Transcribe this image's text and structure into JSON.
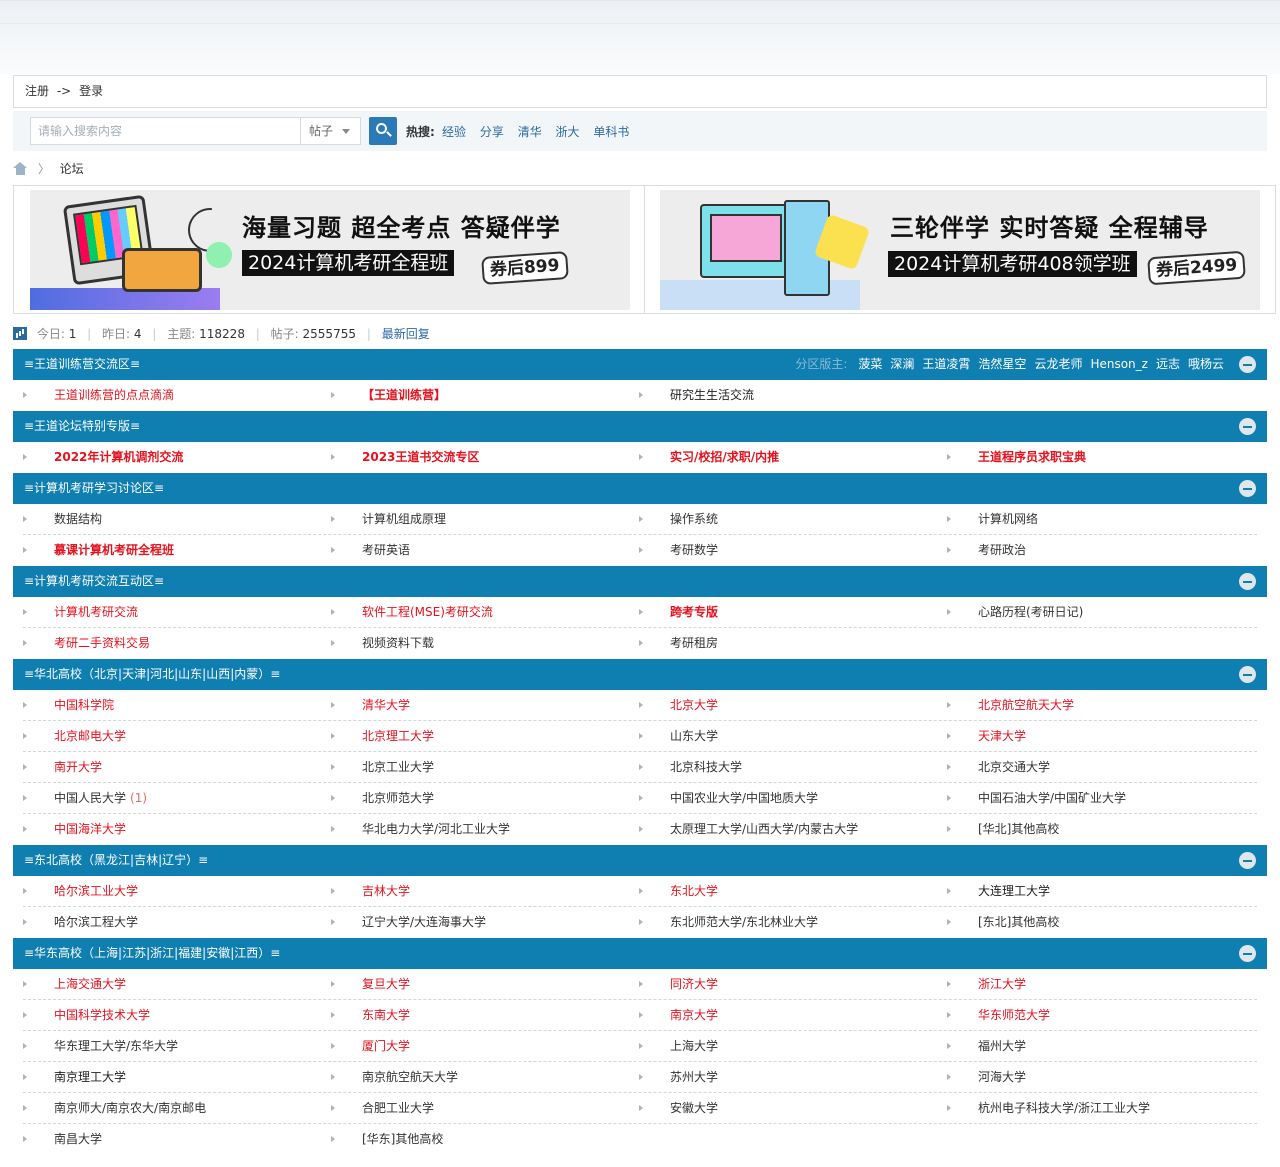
{
  "top": {
    "register": "注册",
    "arrow": "->",
    "login": "登录"
  },
  "search": {
    "placeholder": "请输入搜索内容",
    "type": "帖子",
    "hot_label": "热搜:",
    "hot": [
      "经验",
      "分享",
      "清华",
      "浙大",
      "单科书"
    ]
  },
  "breadcrumb": {
    "current": "论坛"
  },
  "banners": [
    {
      "slogan": "海量习题 超全考点 答疑伴学",
      "course": "2024计算机考研全程班",
      "price": "券后899"
    },
    {
      "slogan": "三轮伴学 实时答疑 全程辅导",
      "course": "2024计算机考研408领学班",
      "price": "券后2499"
    }
  ],
  "stats": {
    "today_label": "今日:",
    "today": "1",
    "yesterday_label": "昨日:",
    "yesterday": "4",
    "topics_label": "主题:",
    "topics": "118228",
    "posts_label": "帖子:",
    "posts": "2555755",
    "latest": "最新回复"
  },
  "categories": [
    {
      "title": "≡王道训练营交流区≡",
      "mod_label": "分区版主:",
      "mods": [
        "菠菜",
        "深澜",
        "王道凌霄",
        "浩然星空",
        "云龙老师",
        "Henson_z",
        "远志",
        "哦杨云"
      ],
      "rows": [
        [
          {
            "name": "王道训练营的点点滴滴",
            "style": "red"
          },
          {
            "name": "【王道训练营】",
            "style": "red-bold"
          },
          {
            "name": "研究生生活交流",
            "style": "black"
          }
        ]
      ]
    },
    {
      "title": "≡王道论坛特别专版≡",
      "rows": [
        [
          {
            "name": "2022年计算机调剂交流",
            "style": "red-bold"
          },
          {
            "name": "2023王道书交流专区",
            "style": "red-bold"
          },
          {
            "name": "实习/校招/求职/内推",
            "style": "red-bold"
          },
          {
            "name": "王道程序员求职宝典",
            "style": "red-bold"
          }
        ]
      ]
    },
    {
      "title": "≡计算机考研学习讨论区≡",
      "rows": [
        [
          {
            "name": "数据结构",
            "style": "normal"
          },
          {
            "name": "计算机组成原理",
            "style": "normal"
          },
          {
            "name": "操作系统",
            "style": "normal"
          },
          {
            "name": "计算机网络",
            "style": "normal"
          }
        ],
        [
          {
            "name": "慕课计算机考研全程班",
            "style": "red-bold"
          },
          {
            "name": "考研英语",
            "style": "normal"
          },
          {
            "name": "考研数学",
            "style": "normal"
          },
          {
            "name": "考研政治",
            "style": "normal"
          }
        ]
      ]
    },
    {
      "title": "≡计算机考研交流互动区≡",
      "rows": [
        [
          {
            "name": "计算机考研交流",
            "style": "red"
          },
          {
            "name": "软件工程(MSE)考研交流",
            "style": "red"
          },
          {
            "name": "跨考专版",
            "style": "red-bold"
          },
          {
            "name": "心路历程(考研日记)",
            "style": "normal"
          }
        ],
        [
          {
            "name": "考研二手资料交易",
            "style": "red"
          },
          {
            "name": "视频资料下载",
            "style": "normal"
          },
          {
            "name": "考研租房",
            "style": "normal"
          }
        ]
      ]
    },
    {
      "title": "≡华北高校（北京|天津|河北|山东|山西|内蒙）≡",
      "rows": [
        [
          {
            "name": "中国科学院",
            "style": "red"
          },
          {
            "name": "清华大学",
            "style": "red"
          },
          {
            "name": "北京大学",
            "style": "red"
          },
          {
            "name": "北京航空航天大学",
            "style": "red"
          }
        ],
        [
          {
            "name": "北京邮电大学",
            "style": "red"
          },
          {
            "name": "北京理工大学",
            "style": "red"
          },
          {
            "name": "山东大学",
            "style": "normal"
          },
          {
            "name": "天津大学",
            "style": "red"
          }
        ],
        [
          {
            "name": "南开大学",
            "style": "red"
          },
          {
            "name": "北京工业大学",
            "style": "normal"
          },
          {
            "name": "北京科技大学",
            "style": "normal"
          },
          {
            "name": "北京交通大学",
            "style": "normal"
          }
        ],
        [
          {
            "name": "中国人民大学",
            "style": "normal",
            "count": "(1)"
          },
          {
            "name": "北京师范大学",
            "style": "normal"
          },
          {
            "name": "中国农业大学/中国地质大学",
            "style": "normal"
          },
          {
            "name": "中国石油大学/中国矿业大学",
            "style": "normal"
          }
        ],
        [
          {
            "name": "中国海洋大学",
            "style": "red"
          },
          {
            "name": "华北电力大学/河北工业大学",
            "style": "normal"
          },
          {
            "name": "太原理工大学/山西大学/内蒙古大学",
            "style": "normal"
          },
          {
            "name": "[华北]其他高校",
            "style": "normal"
          }
        ]
      ]
    },
    {
      "title": "≡东北高校（黑龙江|吉林|辽宁）≡",
      "rows": [
        [
          {
            "name": "哈尔滨工业大学",
            "style": "red"
          },
          {
            "name": "吉林大学",
            "style": "red"
          },
          {
            "name": "东北大学",
            "style": "red"
          },
          {
            "name": "大连理工大学",
            "style": "black"
          }
        ],
        [
          {
            "name": "哈尔滨工程大学",
            "style": "normal"
          },
          {
            "name": "辽宁大学/大连海事大学",
            "style": "normal"
          },
          {
            "name": "东北师范大学/东北林业大学",
            "style": "normal"
          },
          {
            "name": "[东北]其他高校",
            "style": "normal"
          }
        ]
      ]
    },
    {
      "title": "≡华东高校（上海|江苏|浙江|福建|安徽|江西）≡",
      "rows": [
        [
          {
            "name": "上海交通大学",
            "style": "red"
          },
          {
            "name": "复旦大学",
            "style": "red"
          },
          {
            "name": "同济大学",
            "style": "red"
          },
          {
            "name": "浙江大学",
            "style": "red"
          }
        ],
        [
          {
            "name": "中国科学技术大学",
            "style": "red"
          },
          {
            "name": "东南大学",
            "style": "red"
          },
          {
            "name": "南京大学",
            "style": "red"
          },
          {
            "name": "华东师范大学",
            "style": "red"
          }
        ],
        [
          {
            "name": "华东理工大学/东华大学",
            "style": "normal"
          },
          {
            "name": "厦门大学",
            "style": "red"
          },
          {
            "name": "上海大学",
            "style": "normal"
          },
          {
            "name": "福州大学",
            "style": "normal"
          }
        ],
        [
          {
            "name": "南京理工大学",
            "style": "black"
          },
          {
            "name": "南京航空航天大学",
            "style": "normal"
          },
          {
            "name": "苏州大学",
            "style": "normal"
          },
          {
            "name": "河海大学",
            "style": "normal"
          }
        ],
        [
          {
            "name": "南京师大/南京农大/南京邮电",
            "style": "normal"
          },
          {
            "name": "合肥工业大学",
            "style": "normal"
          },
          {
            "name": "安徽大学",
            "style": "normal"
          },
          {
            "name": "杭州电子科技大学/浙江工业大学",
            "style": "normal"
          }
        ],
        [
          {
            "name": "南昌大学",
            "style": "normal"
          },
          {
            "name": "[华东]其他高校",
            "style": "normal"
          }
        ]
      ]
    }
  ]
}
